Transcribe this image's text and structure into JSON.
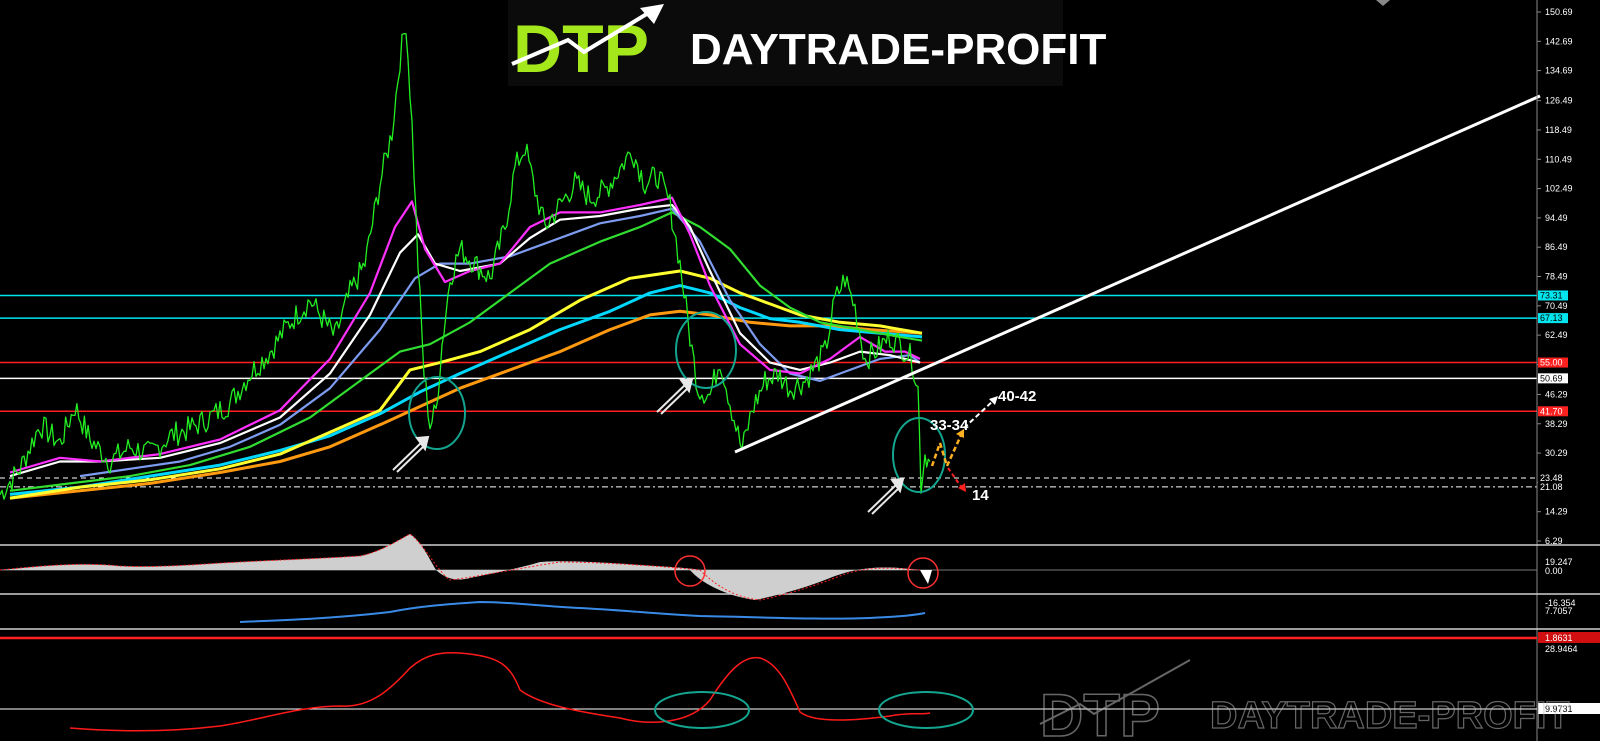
{
  "brand": {
    "logo_letters": "DTP",
    "name": "DAYTRADE-PROFIT",
    "accent": "#a4e81c"
  },
  "price_axis": {
    "ticks": [
      "150.69",
      "142.69",
      "134.69",
      "126.49",
      "118.49",
      "110.49",
      "102.49",
      "94.49",
      "86.49",
      "78.49",
      "70.49",
      "62.49",
      "54.49",
      "46.29",
      "38.29",
      "30.29",
      "22.29",
      "14.29",
      "6.29"
    ]
  },
  "levels": [
    {
      "value": 73.31,
      "label": "73.31",
      "color": "#00e5ee",
      "style": "solid"
    },
    {
      "value": 67.13,
      "label": "67.13",
      "color": "#00e5ee",
      "style": "solid"
    },
    {
      "value": 55.0,
      "label": "55.00",
      "color": "#ff2020",
      "style": "solid"
    },
    {
      "value": 50.69,
      "label": "50.69",
      "color": "#ffffff",
      "style": "solid"
    },
    {
      "value": 41.7,
      "label": "41.70",
      "color": "#ff2020",
      "style": "solid"
    },
    {
      "value": 23.48,
      "label": "23.48",
      "color": "#ffffff",
      "style": "dashed"
    },
    {
      "value": 21.08,
      "label": "21.08",
      "color": "#ffffff",
      "style": "dashdot"
    }
  ],
  "annotations": [
    {
      "text": "40-42",
      "color": "#ffffff"
    },
    {
      "text": "33-34",
      "color": "#ffffff"
    },
    {
      "text": "14",
      "color": "#ffffff"
    }
  ],
  "indicator_axes": {
    "osc": [
      "19.247",
      "0.00",
      "-16.354"
    ],
    "vol": [
      "7.7057",
      "1.8631"
    ],
    "rsi": [
      "28.9464",
      "9.9731"
    ]
  },
  "chart_data": {
    "type": "line",
    "y_range": [
      6.29,
      150.69
    ],
    "series": [
      {
        "key": "price",
        "color": "#22ee22",
        "points": [
          [
            0,
            19
          ],
          [
            20,
            26
          ],
          [
            40,
            38
          ],
          [
            60,
            33
          ],
          [
            75,
            43
          ],
          [
            90,
            34
          ],
          [
            110,
            28
          ],
          [
            130,
            32
          ],
          [
            150,
            30
          ],
          [
            170,
            35
          ],
          [
            190,
            37
          ],
          [
            210,
            40
          ],
          [
            230,
            44
          ],
          [
            250,
            52
          ],
          [
            270,
            58
          ],
          [
            290,
            66
          ],
          [
            310,
            72
          ],
          [
            320,
            68
          ],
          [
            335,
            62
          ],
          [
            350,
            74
          ],
          [
            365,
            82
          ],
          [
            380,
            104
          ],
          [
            392,
            118
          ],
          [
            400,
            138
          ],
          [
            406,
            148
          ],
          [
            412,
            120
          ],
          [
            418,
            82
          ],
          [
            424,
            52
          ],
          [
            430,
            38
          ],
          [
            436,
            42
          ],
          [
            442,
            60
          ],
          [
            450,
            78
          ],
          [
            460,
            86
          ],
          [
            475,
            82
          ],
          [
            490,
            78
          ],
          [
            505,
            92
          ],
          [
            515,
            108
          ],
          [
            525,
            114
          ],
          [
            535,
            102
          ],
          [
            545,
            92
          ],
          [
            560,
            98
          ],
          [
            575,
            104
          ],
          [
            590,
            100
          ],
          [
            605,
            102
          ],
          [
            620,
            108
          ],
          [
            632,
            113
          ],
          [
            645,
            104
          ],
          [
            658,
            106
          ],
          [
            670,
            98
          ],
          [
            680,
            82
          ],
          [
            690,
            62
          ],
          [
            698,
            48
          ],
          [
            710,
            46
          ],
          [
            720,
            56
          ],
          [
            732,
            42
          ],
          [
            742,
            31
          ],
          [
            752,
            42
          ],
          [
            765,
            50
          ],
          [
            778,
            52
          ],
          [
            790,
            48
          ],
          [
            805,
            50
          ],
          [
            815,
            54
          ],
          [
            825,
            58
          ],
          [
            835,
            72
          ],
          [
            845,
            78
          ],
          [
            855,
            70
          ],
          [
            865,
            56
          ],
          [
            875,
            58
          ],
          [
            890,
            62
          ],
          [
            900,
            60
          ],
          [
            912,
            56
          ],
          [
            918,
            48
          ],
          [
            921,
            22
          ],
          [
            925,
            30
          ],
          [
            930,
            28
          ]
        ]
      },
      {
        "key": "ema-magenta",
        "color": "#ff30ff",
        "points": [
          [
            10,
            25
          ],
          [
            60,
            29
          ],
          [
            100,
            28
          ],
          [
            160,
            30
          ],
          [
            220,
            34
          ],
          [
            280,
            42
          ],
          [
            330,
            56
          ],
          [
            370,
            74
          ],
          [
            395,
            92
          ],
          [
            412,
            99
          ],
          [
            425,
            86
          ],
          [
            445,
            77
          ],
          [
            470,
            80
          ],
          [
            500,
            82
          ],
          [
            530,
            92
          ],
          [
            560,
            96
          ],
          [
            600,
            96
          ],
          [
            640,
            98
          ],
          [
            672,
            100
          ],
          [
            690,
            90
          ],
          [
            710,
            76
          ],
          [
            740,
            60
          ],
          [
            770,
            53
          ],
          [
            800,
            52
          ],
          [
            830,
            56
          ],
          [
            860,
            62
          ],
          [
            885,
            58
          ],
          [
            905,
            58
          ],
          [
            920,
            56
          ]
        ]
      },
      {
        "key": "ema-white",
        "color": "#ffffff",
        "points": [
          [
            10,
            24
          ],
          [
            60,
            28
          ],
          [
            100,
            28
          ],
          [
            160,
            29
          ],
          [
            220,
            33
          ],
          [
            280,
            40
          ],
          [
            330,
            52
          ],
          [
            370,
            68
          ],
          [
            400,
            85
          ],
          [
            418,
            90
          ],
          [
            435,
            82
          ],
          [
            460,
            80
          ],
          [
            500,
            82
          ],
          [
            530,
            89
          ],
          [
            560,
            94
          ],
          [
            600,
            95
          ],
          [
            640,
            97
          ],
          [
            672,
            98
          ],
          [
            690,
            92
          ],
          [
            710,
            80
          ],
          [
            740,
            63
          ],
          [
            770,
            55
          ],
          [
            800,
            53
          ],
          [
            830,
            55
          ],
          [
            860,
            58
          ],
          [
            890,
            57
          ],
          [
            920,
            55
          ]
        ]
      },
      {
        "key": "ema-blue",
        "color": "#7d9cf0",
        "points": [
          [
            80,
            24
          ],
          [
            130,
            26
          ],
          [
            180,
            28
          ],
          [
            230,
            32
          ],
          [
            280,
            38
          ],
          [
            330,
            48
          ],
          [
            380,
            64
          ],
          [
            415,
            78
          ],
          [
            440,
            82
          ],
          [
            470,
            82
          ],
          [
            510,
            84
          ],
          [
            550,
            88
          ],
          [
            600,
            93
          ],
          [
            640,
            95
          ],
          [
            672,
            97
          ],
          [
            700,
            88
          ],
          [
            730,
            72
          ],
          [
            760,
            60
          ],
          [
            790,
            52
          ],
          [
            820,
            50
          ],
          [
            850,
            53
          ],
          [
            880,
            56
          ],
          [
            910,
            57
          ],
          [
            920,
            55
          ]
        ]
      },
      {
        "key": "ema-green",
        "color": "#30dd30",
        "points": [
          [
            10,
            20
          ],
          [
            70,
            22
          ],
          [
            130,
            24
          ],
          [
            190,
            27
          ],
          [
            250,
            32
          ],
          [
            310,
            40
          ],
          [
            360,
            50
          ],
          [
            400,
            58
          ],
          [
            430,
            60
          ],
          [
            470,
            66
          ],
          [
            510,
            74
          ],
          [
            550,
            82
          ],
          [
            600,
            88
          ],
          [
            640,
            92
          ],
          [
            672,
            96
          ],
          [
            700,
            92
          ],
          [
            730,
            86
          ],
          [
            760,
            76
          ],
          [
            790,
            70
          ],
          [
            820,
            66
          ],
          [
            860,
            64
          ],
          [
            900,
            62
          ],
          [
            922,
            61
          ]
        ]
      },
      {
        "key": "ema-yellow",
        "color": "#ffff30",
        "points": [
          [
            10,
            18
          ],
          [
            80,
            21
          ],
          [
            150,
            23
          ],
          [
            220,
            26
          ],
          [
            280,
            30
          ],
          [
            330,
            36
          ],
          [
            380,
            42
          ],
          [
            410,
            53
          ],
          [
            440,
            55
          ],
          [
            480,
            58
          ],
          [
            530,
            64
          ],
          [
            580,
            72
          ],
          [
            630,
            78
          ],
          [
            680,
            80
          ],
          [
            710,
            78
          ],
          [
            740,
            74
          ],
          [
            770,
            71
          ],
          [
            800,
            68
          ],
          [
            840,
            66
          ],
          [
            880,
            65
          ],
          [
            922,
            63
          ]
        ]
      },
      {
        "key": "ema-cyan",
        "color": "#00d8ff",
        "points": [
          [
            10,
            19
          ],
          [
            80,
            21
          ],
          [
            150,
            24
          ],
          [
            220,
            27
          ],
          [
            280,
            31
          ],
          [
            330,
            35
          ],
          [
            380,
            41
          ],
          [
            420,
            47
          ],
          [
            460,
            52
          ],
          [
            510,
            58
          ],
          [
            560,
            64
          ],
          [
            610,
            69
          ],
          [
            650,
            74
          ],
          [
            680,
            76
          ],
          [
            710,
            74
          ],
          [
            740,
            70
          ],
          [
            770,
            67
          ],
          [
            800,
            66
          ],
          [
            840,
            64
          ],
          [
            880,
            63
          ],
          [
            922,
            62
          ]
        ]
      },
      {
        "key": "ema-orange",
        "color": "#ff9a10",
        "points": [
          [
            10,
            18
          ],
          [
            80,
            20
          ],
          [
            150,
            22
          ],
          [
            220,
            25
          ],
          [
            280,
            28
          ],
          [
            330,
            32
          ],
          [
            380,
            38
          ],
          [
            420,
            43
          ],
          [
            460,
            48
          ],
          [
            510,
            53
          ],
          [
            560,
            58
          ],
          [
            610,
            64
          ],
          [
            650,
            68
          ],
          [
            680,
            69
          ],
          [
            710,
            68
          ],
          [
            750,
            66
          ],
          [
            790,
            65
          ],
          [
            830,
            65
          ],
          [
            870,
            64
          ],
          [
            922,
            63
          ]
        ]
      }
    ]
  }
}
